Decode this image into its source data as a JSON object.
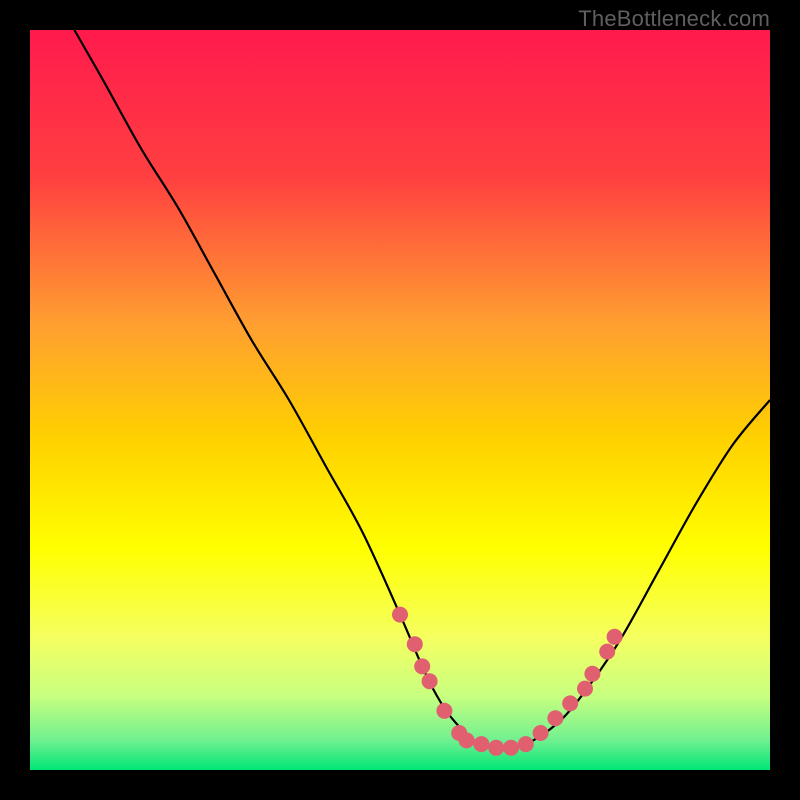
{
  "watermark": "TheBottleneck.com",
  "chart_data": {
    "type": "line",
    "title": "",
    "xlabel": "",
    "ylabel": "",
    "xlim": [
      0,
      100
    ],
    "ylim": [
      0,
      100
    ],
    "background_gradient": {
      "stops": [
        {
          "pct": 0,
          "color": "#ff1a4d"
        },
        {
          "pct": 20,
          "color": "#ff4040"
        },
        {
          "pct": 40,
          "color": "#ffa030"
        },
        {
          "pct": 55,
          "color": "#ffd000"
        },
        {
          "pct": 70,
          "color": "#ffff00"
        },
        {
          "pct": 82,
          "color": "#f5ff60"
        },
        {
          "pct": 90,
          "color": "#c8ff80"
        },
        {
          "pct": 96,
          "color": "#70f090"
        },
        {
          "pct": 100,
          "color": "#00e676"
        }
      ]
    },
    "curve": {
      "description": "V-shaped bottleneck curve, y is distance from optimal balance (0 = good at bottom, 100 = bad at top)",
      "x": [
        6,
        10,
        15,
        20,
        25,
        30,
        35,
        40,
        45,
        50,
        53,
        55,
        57,
        60,
        63,
        65,
        68,
        72,
        76,
        80,
        85,
        90,
        95,
        100
      ],
      "y": [
        100,
        93,
        84,
        76,
        67,
        58,
        50,
        41,
        32,
        21,
        14,
        10,
        7,
        4,
        3,
        3,
        4,
        7,
        12,
        18,
        27,
        36,
        44,
        50
      ]
    },
    "markers": {
      "color": "#e06070",
      "radius_px": 8,
      "points": [
        {
          "x": 50,
          "y": 21
        },
        {
          "x": 52,
          "y": 17
        },
        {
          "x": 53,
          "y": 14
        },
        {
          "x": 54,
          "y": 12
        },
        {
          "x": 56,
          "y": 8
        },
        {
          "x": 58,
          "y": 5
        },
        {
          "x": 59,
          "y": 4
        },
        {
          "x": 61,
          "y": 3.5
        },
        {
          "x": 63,
          "y": 3
        },
        {
          "x": 65,
          "y": 3
        },
        {
          "x": 67,
          "y": 3.5
        },
        {
          "x": 69,
          "y": 5
        },
        {
          "x": 71,
          "y": 7
        },
        {
          "x": 73,
          "y": 9
        },
        {
          "x": 75,
          "y": 11
        },
        {
          "x": 76,
          "y": 13
        },
        {
          "x": 78,
          "y": 16
        },
        {
          "x": 79,
          "y": 18
        }
      ]
    }
  }
}
